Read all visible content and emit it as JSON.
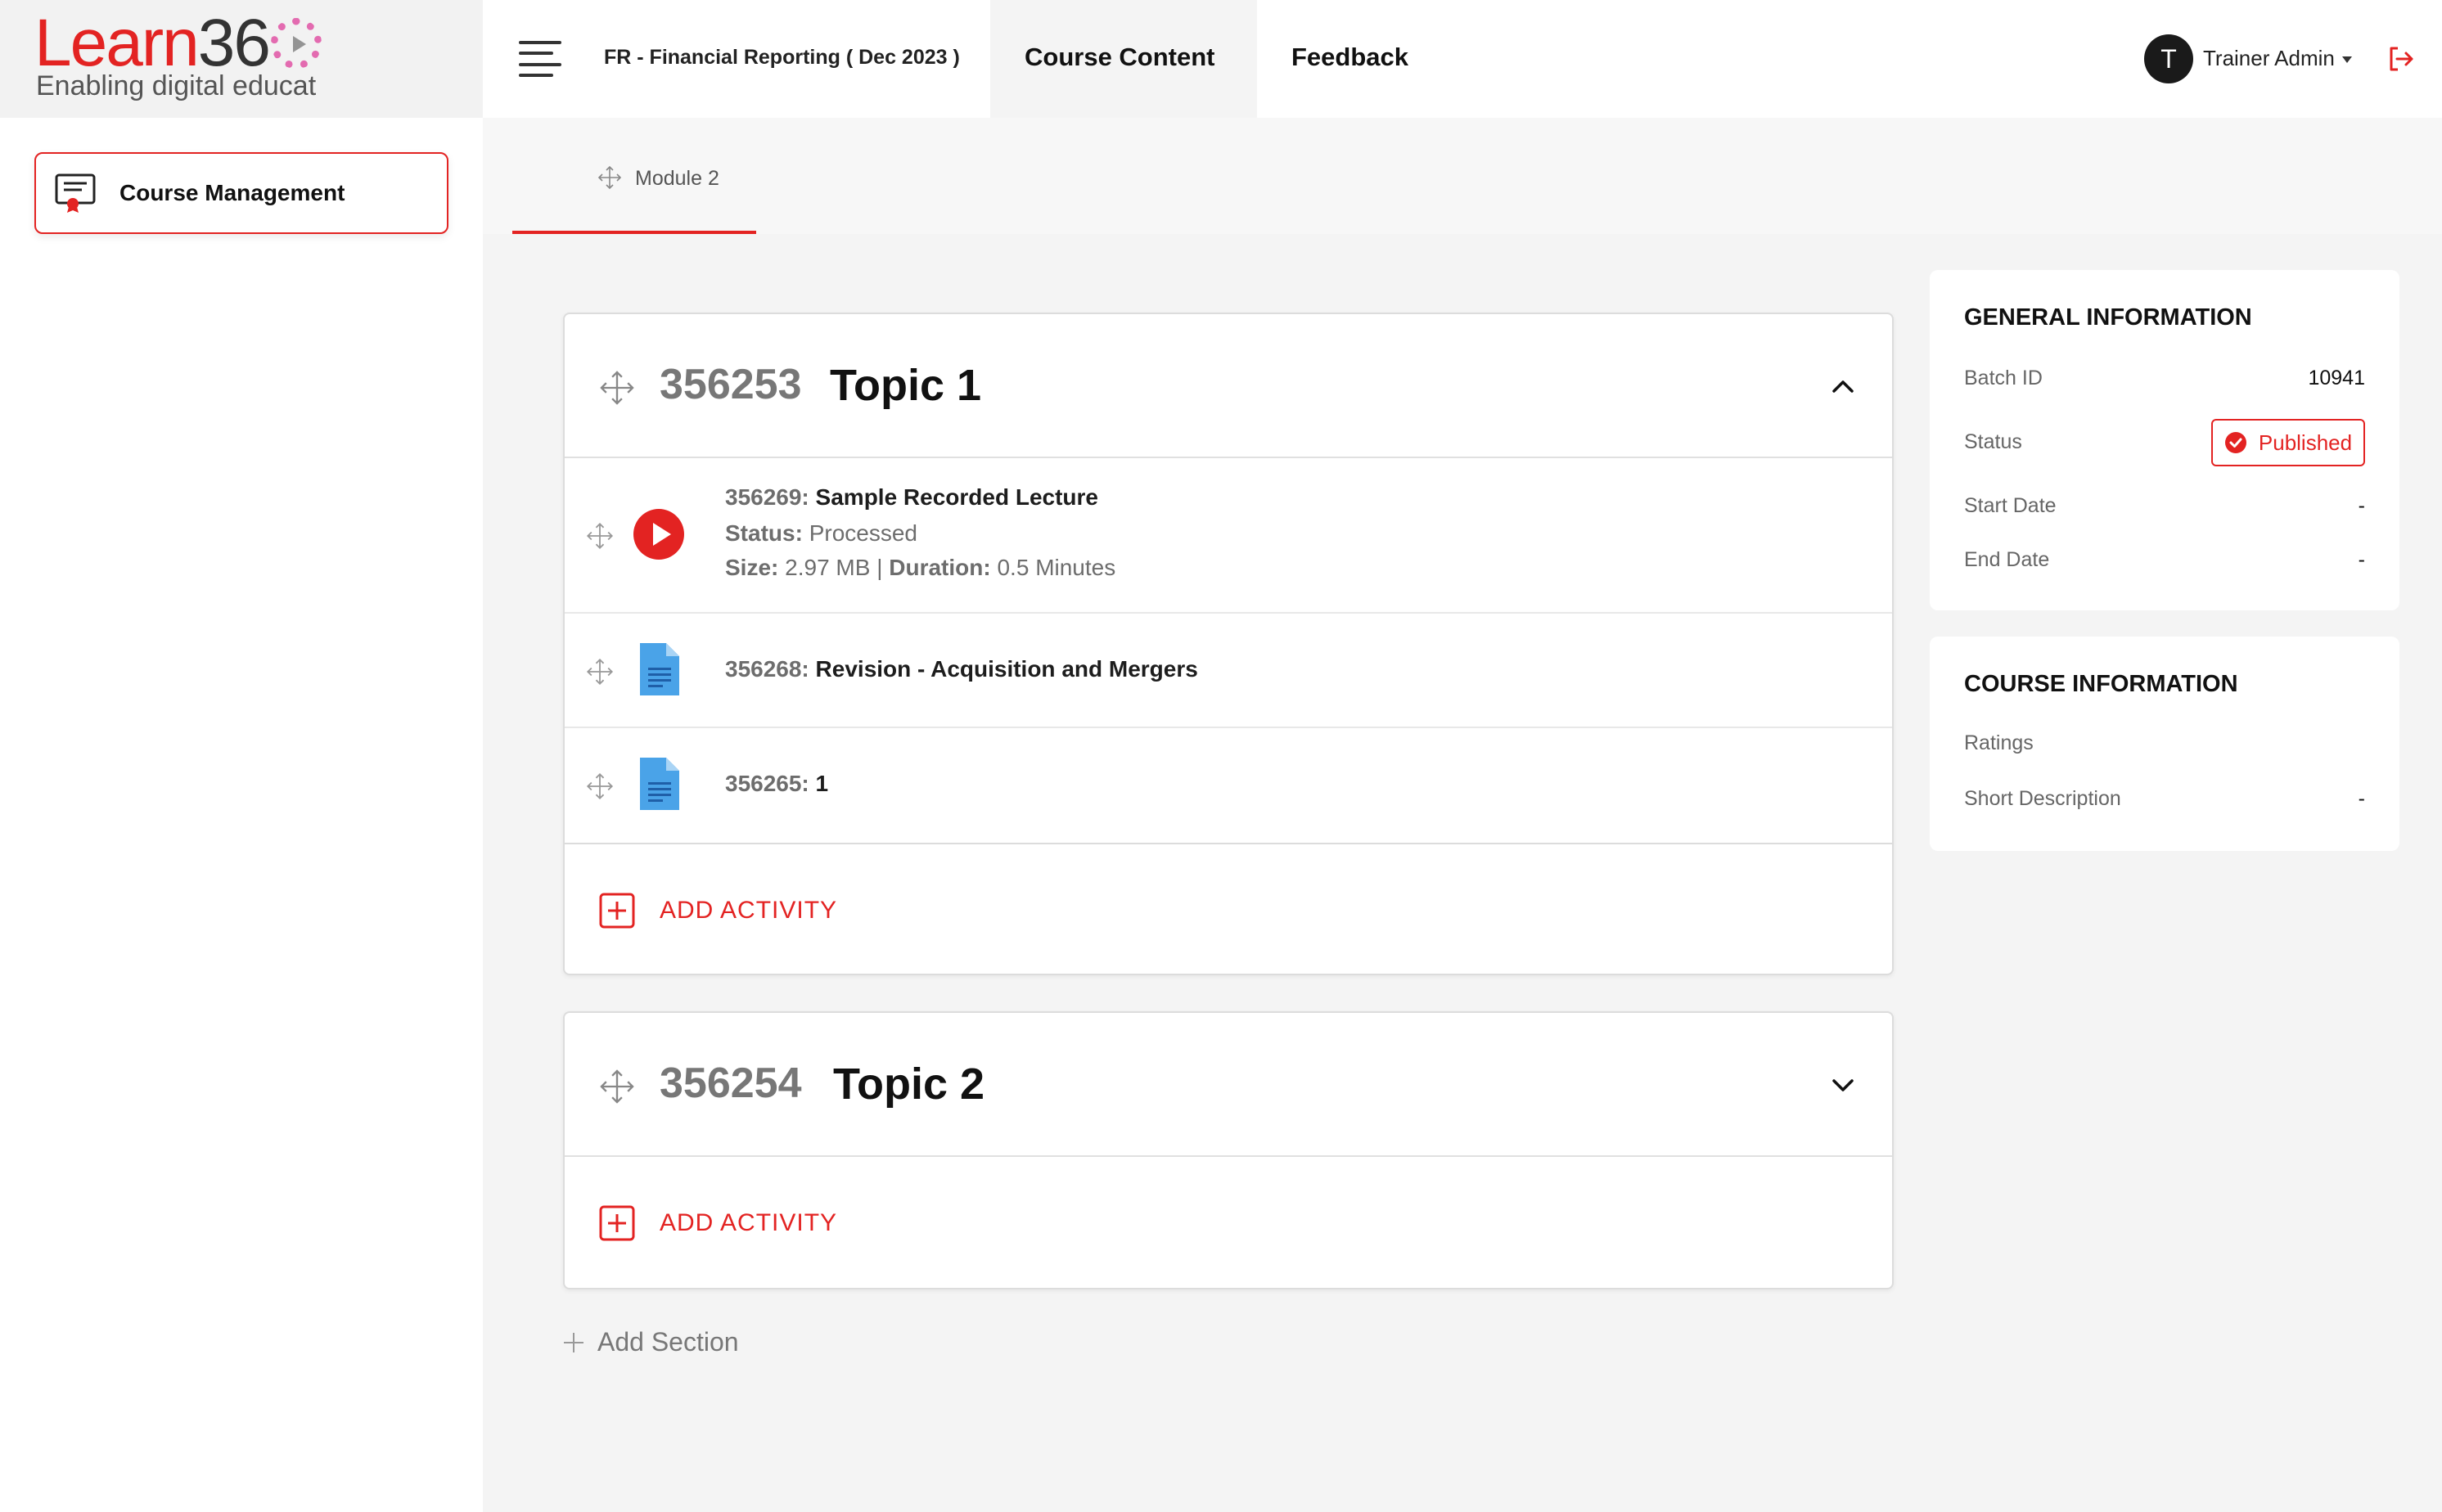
{
  "brand": {
    "logo_learn": "Learn",
    "logo_36": "36",
    "tagline": "Enabling digital educat"
  },
  "header": {
    "course_title": "FR - Financial Reporting ( Dec 2023 )",
    "tabs": [
      {
        "label": "Course Content",
        "active": true
      },
      {
        "label": "Feedback",
        "active": false
      }
    ],
    "user": {
      "initial": "T",
      "name": "Trainer Admin"
    }
  },
  "sidebar": {
    "items": [
      {
        "label": "Course Management",
        "active": true
      }
    ]
  },
  "module_tabs": [
    {
      "label": "Module 2",
      "active": true
    }
  ],
  "sections": [
    {
      "id": "356253",
      "title": "Topic 1",
      "expanded": true,
      "activities": [
        {
          "id": "356269:",
          "title": "Sample Recorded Lecture",
          "type": "video",
          "status_label": "Status:",
          "status": "Processed",
          "size_label": "Size:",
          "size": "2.97 MB",
          "sep": "|",
          "duration_label": "Duration:",
          "duration": "0.5 Minutes"
        },
        {
          "id": "356268:",
          "title": "Revision - Acquisition and Mergers",
          "type": "document"
        },
        {
          "id": "356265:",
          "title": "1",
          "type": "document"
        }
      ],
      "add_label": "ADD ACTIVITY"
    },
    {
      "id": "356254",
      "title": "Topic 2",
      "expanded": false,
      "activities": [],
      "add_label": "ADD ACTIVITY"
    }
  ],
  "add_section_label": "Add Section",
  "general_info": {
    "heading": "GENERAL INFORMATION",
    "batch_id_label": "Batch ID",
    "batch_id": "10941",
    "status_label": "Status",
    "status": "Published",
    "start_date_label": "Start Date",
    "start_date": "-",
    "end_date_label": "End Date",
    "end_date": "-"
  },
  "course_info": {
    "heading": "COURSE INFORMATION",
    "ratings_label": "Ratings",
    "short_desc_label": "Short Description",
    "short_desc": "-"
  },
  "colors": {
    "accent": "#e32322",
    "doc_blue": "#4aa3e8",
    "text_muted": "#6d6d6d"
  },
  "icons": [
    "hamburger-icon",
    "logout-icon",
    "certificate-icon",
    "move-icon",
    "chevron-up-icon",
    "chevron-down-icon",
    "play-icon",
    "document-icon",
    "plus-box-icon",
    "plus-icon",
    "check-circle-icon"
  ]
}
